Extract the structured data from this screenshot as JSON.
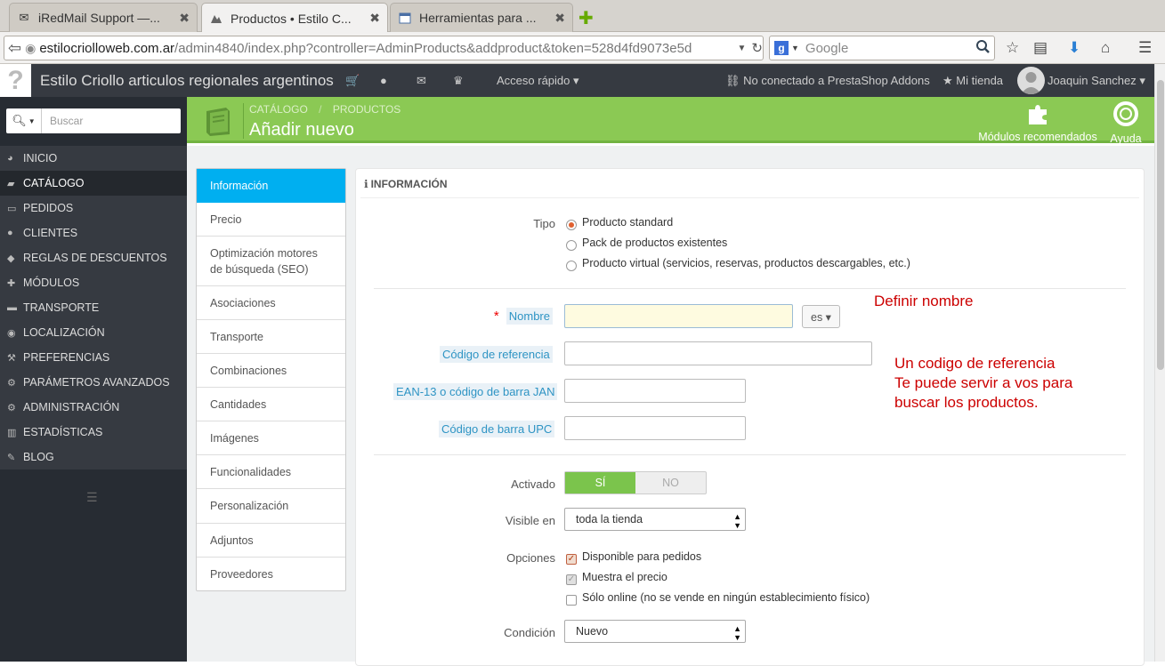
{
  "browser": {
    "tabs": [
      {
        "title": "iRedMail Support —...",
        "icon": "mail-icon"
      },
      {
        "title": "Productos • Estilo C...",
        "icon": "prestashop-icon"
      },
      {
        "title": "Herramientas para ...",
        "icon": "calendar-icon"
      }
    ],
    "close_glyph": "✖",
    "new_tab_glyph": "✚",
    "url_host": "estilocriolloweb.com.ar",
    "url_path": "/admin4840/index.php?controller=AdminProducts&addproduct&token=528d4fd9073e5d",
    "search_placeholder": "Google"
  },
  "header": {
    "shop_title": "Estilo Criollo articulos regionales argentinos",
    "quick_access": "Acceso rápido",
    "addons_status": "No conectado a PrestaShop Addons",
    "my_shop": "Mi tienda",
    "user_name": "Joaquin Sanchez"
  },
  "sidebar": {
    "search_placeholder": "Buscar",
    "items": [
      {
        "label": "Inicio",
        "icon": "dashboard-icon"
      },
      {
        "label": "Catálogo",
        "icon": "book-icon"
      },
      {
        "label": "Pedidos",
        "icon": "credit-card-icon"
      },
      {
        "label": "Clientes",
        "icon": "users-icon"
      },
      {
        "label": "Reglas de descuentos",
        "icon": "tag-icon"
      },
      {
        "label": "Módulos",
        "icon": "puzzle-icon"
      },
      {
        "label": "Transporte",
        "icon": "truck-icon"
      },
      {
        "label": "Localización",
        "icon": "globe-icon"
      },
      {
        "label": "Preferencias",
        "icon": "wrench-icon"
      },
      {
        "label": "Parámetros avanzados",
        "icon": "cogs-icon"
      },
      {
        "label": "Administración",
        "icon": "cog-icon"
      },
      {
        "label": "Estadísticas",
        "icon": "bar-chart-icon"
      },
      {
        "label": "Blog",
        "icon": "edit-icon"
      }
    ]
  },
  "toolbar": {
    "breadcrumb": [
      "Catálogo",
      "Productos"
    ],
    "title": "Añadir nuevo",
    "recommended_modules": "Módulos recomendados",
    "help": "Ayuda"
  },
  "product_tabs": [
    "Información",
    "Precio",
    "Optimización motores de búsqueda (SEO)",
    "Asociaciones",
    "Transporte",
    "Combinaciones",
    "Cantidades",
    "Imágenes",
    "Funcionalidades",
    "Personalización",
    "Adjuntos",
    "Proveedores"
  ],
  "form": {
    "panel_title": "Información",
    "type_label": "Tipo",
    "type_options": [
      "Producto standard",
      "Pack de productos existentes",
      "Producto virtual (servicios, reservas, productos descargables, etc.)"
    ],
    "name_label": "Nombre",
    "name_value": "",
    "lang": "es",
    "reference_label": "Código de referencia",
    "ean_label": "EAN-13 o código de barra JAN",
    "upc_label": "Código de barra UPC",
    "active_label": "Activado",
    "active_yes": "SÍ",
    "active_no": "NO",
    "visible_label": "Visible en",
    "visible_value": "toda la tienda",
    "options_label": "Opciones",
    "options": [
      {
        "label": "Disponible para pedidos",
        "checked": true
      },
      {
        "label": "Muestra el precio",
        "checked": true
      },
      {
        "label": "Sólo online (no se vende en ningún establecimiento físico)",
        "checked": false
      }
    ],
    "condition_label": "Condición",
    "condition_value": "Nuevo"
  },
  "annotations": {
    "name_note": "Definir nombre",
    "ref_note": [
      "Un codigo de referencia",
      "Te puede servir a vos para",
      "buscar los productos."
    ]
  },
  "colors": {
    "accent_green": "#8bc954",
    "active_tab_blue": "#00aff0",
    "note_red": "#cc0000"
  }
}
